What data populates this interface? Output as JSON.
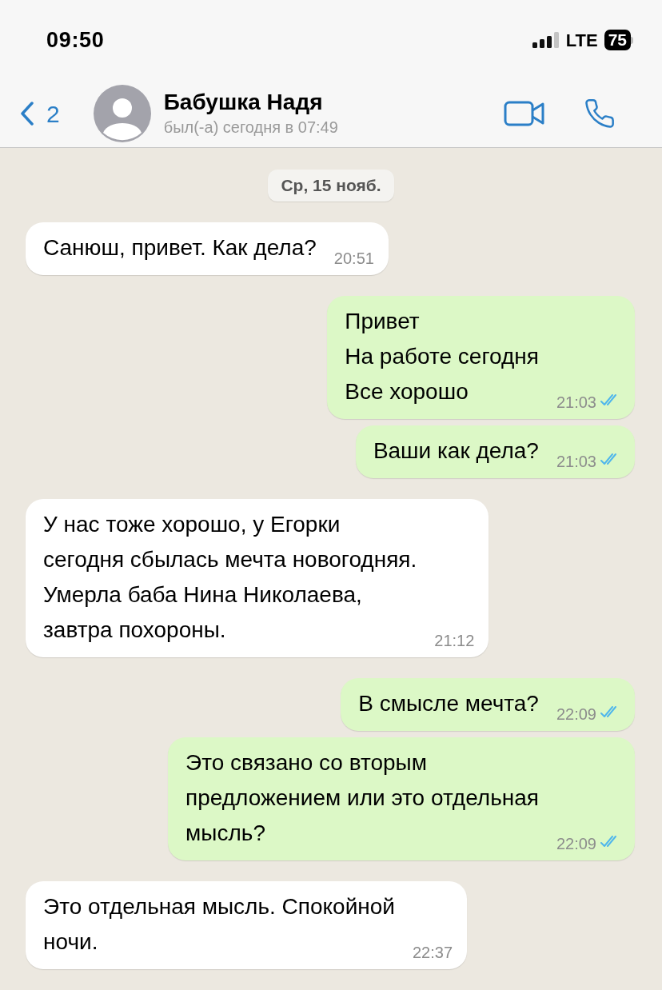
{
  "status_bar": {
    "time": "09:50",
    "network": "LTE",
    "battery": "75"
  },
  "header": {
    "back_count": "2",
    "contact_name": "Бабушка Надя",
    "last_seen": "был(-а) сегодня в 07:49"
  },
  "date_label": "Ср, 15 нояб.",
  "messages": [
    {
      "kind": "in",
      "text": "Санюш, привет. Как дела?",
      "time": "20:51"
    },
    {
      "kind": "out",
      "text": "Привет\nНа работе сегодня\nВсе хорошо",
      "time": "21:03",
      "read": true
    },
    {
      "kind": "out",
      "text": "Ваши как дела?",
      "time": "21:03",
      "read": true
    },
    {
      "kind": "in",
      "text": "У нас тоже хорошо, у Егорки\nсегодня сбылась мечта новогодняя.\nУмерла баба Нина Николаева,\nзавтра похороны.",
      "time": "21:12"
    },
    {
      "kind": "out",
      "text": "В смысле мечта?",
      "time": "22:09",
      "read": true
    },
    {
      "kind": "out",
      "text": "Это связано со вторым\nпредложением или это отдельная\nмысль?",
      "time": "22:09",
      "read": true
    },
    {
      "kind": "in",
      "text": "Это отдельная мысль. Спокойной\nночи.",
      "time": "22:37"
    }
  ]
}
